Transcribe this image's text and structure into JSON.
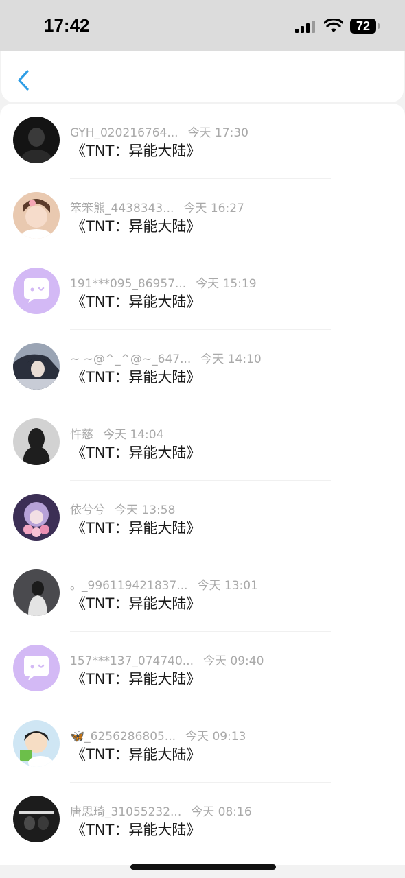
{
  "status_bar": {
    "time": "17:42",
    "battery": "72",
    "icons": [
      "signal-icon",
      "wifi-icon",
      "battery-icon"
    ]
  },
  "nav": {
    "back_icon": "chevron-left-icon",
    "accent": "#2f9ee6"
  },
  "rows": [
    {
      "name": "GYH_020216764...",
      "time": "今天 17:30",
      "title": "《TNT：异能大陆》",
      "avatar": "photo-dark"
    },
    {
      "name": "笨笨熊_4438343...",
      "time": "今天 16:27",
      "title": "《TNT：异能大陆》",
      "avatar": "photo-girl"
    },
    {
      "name": "191***095_86957...",
      "time": "今天 15:19",
      "title": "《TNT：异能大陆》",
      "avatar": "default-bubble"
    },
    {
      "name": "~ ~@^_^@~_647...",
      "time": "今天 14:10",
      "title": "《TNT：异能大陆》",
      "avatar": "photo-anime"
    },
    {
      "name": "忤慈",
      "time": "今天 14:04",
      "title": "《TNT：异能大陆》",
      "avatar": "photo-gray"
    },
    {
      "name": "依兮兮",
      "time": "今天 13:58",
      "title": "《TNT：异能大陆》",
      "avatar": "photo-flowers"
    },
    {
      "name": "。_996119421837...",
      "time": "今天 13:01",
      "title": "《TNT：异能大陆》",
      "avatar": "photo-night"
    },
    {
      "name": "157***137_074740...",
      "time": "今天 09:40",
      "title": "《TNT：异能大陆》",
      "avatar": "default-bubble"
    },
    {
      "name": "🦋_6256286805...",
      "time": "今天 09:13",
      "title": "《TNT：异能大陆》",
      "avatar": "photo-cartoon"
    },
    {
      "name": "唐思琦_31055232...",
      "time": "今天 08:16",
      "title": "《TNT：异能大陆》",
      "avatar": "photo-group"
    }
  ]
}
